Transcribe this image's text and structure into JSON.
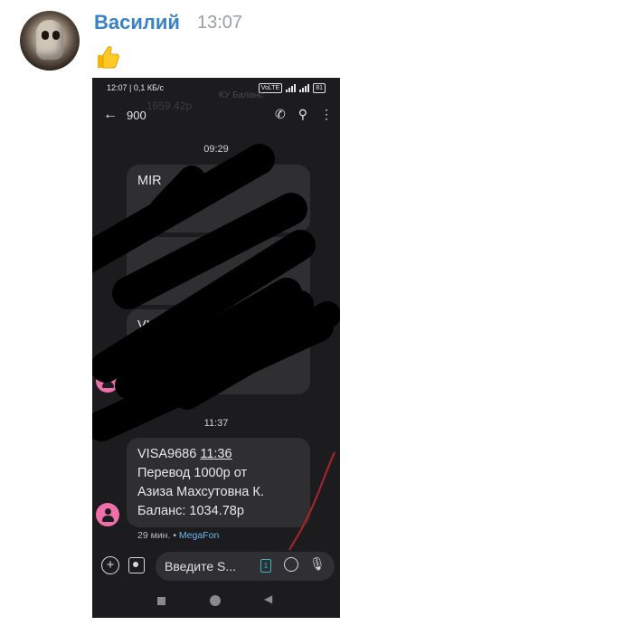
{
  "message": {
    "sender": "Василий",
    "time": "13:07",
    "reaction_icon": "thumbs-up-emoji"
  },
  "phone": {
    "status_bar": {
      "left": "12:07 | 0,1 КБ/с",
      "ghost_text": "КУ Баланс",
      "ghost_text_2": "1659.42р",
      "network": "VoLTE",
      "battery": "81"
    },
    "app_bar": {
      "back_icon": "arrow-left-icon",
      "title": "900",
      "icons": [
        "phone-icon",
        "search-icon",
        "more-vert-icon"
      ]
    },
    "timestamps": [
      "09:29",
      "11:37"
    ],
    "visible_fragments": [
      "MIR",
      "VISA"
    ],
    "last_message": {
      "line1_card": "VISA9686",
      "line1_time": "11:36",
      "line2": "Перевод 1000р от",
      "line3": "Азиза Махсутовна К.",
      "line4": "Баланс: 1034.78р",
      "age": "29 мин.",
      "operator": "MegaFon"
    },
    "composer": {
      "placeholder": "Введите S...",
      "sim_slot": "1",
      "icons": [
        "add-circle-icon",
        "gallery-icon",
        "sim-card-icon",
        "emoji-icon",
        "microphone-icon"
      ]
    },
    "nav_bar": {
      "icons": [
        "recents-icon",
        "home-icon",
        "back-icon"
      ]
    }
  },
  "colors": {
    "sender_name": "#3a82c4",
    "phone_bg": "#1c1c1e",
    "bubble": "#2f2f32",
    "contact_avatar": "#f06ea9",
    "operator": "#6bb6e8",
    "sim_accent": "#36b5c8",
    "red_pen": "#a3242a",
    "redaction": "#000000"
  }
}
